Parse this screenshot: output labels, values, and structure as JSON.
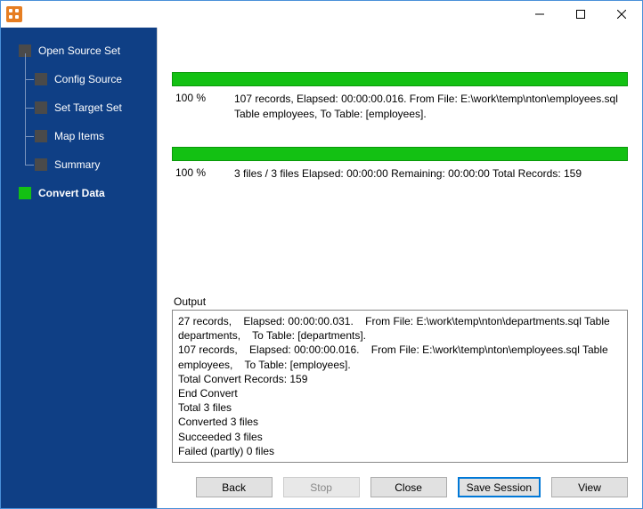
{
  "titlebar": {
    "icon_name": "app-icon"
  },
  "sidebar": {
    "root": "Open Source Set",
    "children": [
      "Config Source",
      "Set Target Set",
      "Map Items",
      "Summary"
    ],
    "active": "Convert Data"
  },
  "progress": {
    "task": {
      "percent": "100 %",
      "detail": "107 records,    Elapsed: 00:00:00.016.    From File: E:\\work\\temp\\nton\\employees.sql Table employees,    To Table: [employees]."
    },
    "overall": {
      "percent": "100 %",
      "detail": "3 files / 3 files    Elapsed: 00:00:00    Remaining: 00:00:00    Total Records: 159"
    }
  },
  "output": {
    "label": "Output",
    "text": "27 records,    Elapsed: 00:00:00.031.    From File: E:\\work\\temp\\nton\\departments.sql Table departments,    To Table: [departments].\n107 records,    Elapsed: 00:00:00.016.    From File: E:\\work\\temp\\nton\\employees.sql Table employees,    To Table: [employees].\nTotal Convert Records: 159\nEnd Convert\nTotal 3 files\nConverted 3 files\nSucceeded 3 files\nFailed (partly) 0 files"
  },
  "buttons": {
    "back": "Back",
    "stop": "Stop",
    "close": "Close",
    "save_session": "Save Session",
    "view": "View"
  }
}
